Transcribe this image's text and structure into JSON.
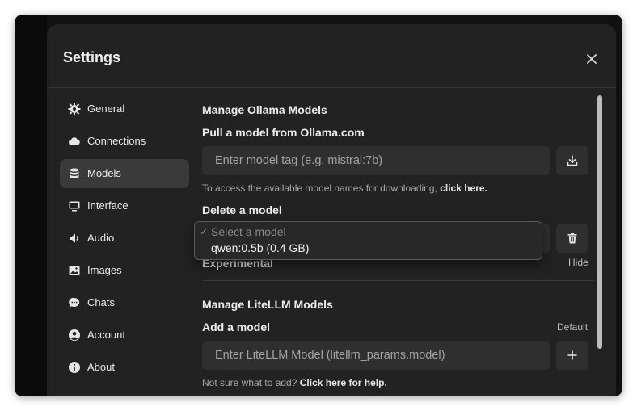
{
  "modal": {
    "title": "Settings"
  },
  "sidebar": {
    "items": [
      {
        "label": "General",
        "icon": "gear-icon"
      },
      {
        "label": "Connections",
        "icon": "cloud-icon"
      },
      {
        "label": "Models",
        "icon": "database-icon",
        "active": true
      },
      {
        "label": "Interface",
        "icon": "monitor-icon"
      },
      {
        "label": "Audio",
        "icon": "speaker-icon"
      },
      {
        "label": "Images",
        "icon": "image-icon"
      },
      {
        "label": "Chats",
        "icon": "chat-bubble-icon"
      },
      {
        "label": "Account",
        "icon": "user-circle-icon"
      },
      {
        "label": "About",
        "icon": "info-icon"
      }
    ]
  },
  "ollama": {
    "section_title": "Manage Ollama Models",
    "pull_title": "Pull a model from Ollama.com",
    "pull_placeholder": "Enter model tag (e.g. mistral:7b)",
    "hint_prefix": "To access the available model names for downloading,",
    "hint_link": "click here.",
    "delete_title": "Delete a model",
    "select_placeholder": "Select a model",
    "select_option": "qwen:0.5b (0.4 GB)",
    "experimental_label": "Experimental",
    "experimental_toggle": "Hide"
  },
  "litellm": {
    "section_title": "Manage LiteLLM Models",
    "add_title": "Add a model",
    "add_mode": "Default",
    "model_placeholder": "Enter LiteLLM Model (litellm_params.model)",
    "help_prefix": "Not sure what to add?",
    "help_link": "Click here for help."
  },
  "colors": {
    "window_bg": "#111111",
    "modal_bg": "#222222",
    "input_bg": "#2f2f2f",
    "active_nav_bg": "#3a3a3a"
  }
}
